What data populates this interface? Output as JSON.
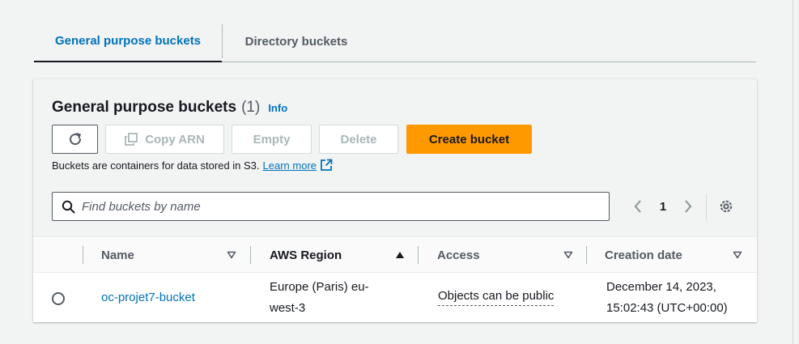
{
  "tabs": [
    {
      "label": "General purpose buckets",
      "active": true
    },
    {
      "label": "Directory buckets",
      "active": false
    }
  ],
  "panel": {
    "title": "General purpose buckets",
    "count": "(1)",
    "info": "Info",
    "description": "Buckets are containers for data stored in S3.",
    "learn_more": "Learn more"
  },
  "toolbar": {
    "refresh_icon": "refresh-icon",
    "copy_arn": "Copy ARN",
    "empty": "Empty",
    "delete": "Delete",
    "create_bucket": "Create bucket"
  },
  "search": {
    "placeholder": "Find buckets by name",
    "value": ""
  },
  "pagination": {
    "current_page": "1"
  },
  "table": {
    "columns": [
      "Name",
      "AWS Region",
      "Access",
      "Creation date"
    ],
    "sort": {
      "column": "AWS Region",
      "direction": "ascending"
    },
    "rows": [
      {
        "name": "oc-projet7-bucket",
        "region": "Europe (Paris) eu-west-3",
        "access": "Objects can be public",
        "creation_date": "December 14, 2023, 15:02:43 (UTC+00:00)",
        "selected": false
      }
    ]
  },
  "colors": {
    "primary_button": "#ff9900",
    "link": "#0073bb",
    "text": "#16191f",
    "muted": "#545b64",
    "disabled": "#aab7b8",
    "background": "#f2f3f3"
  }
}
